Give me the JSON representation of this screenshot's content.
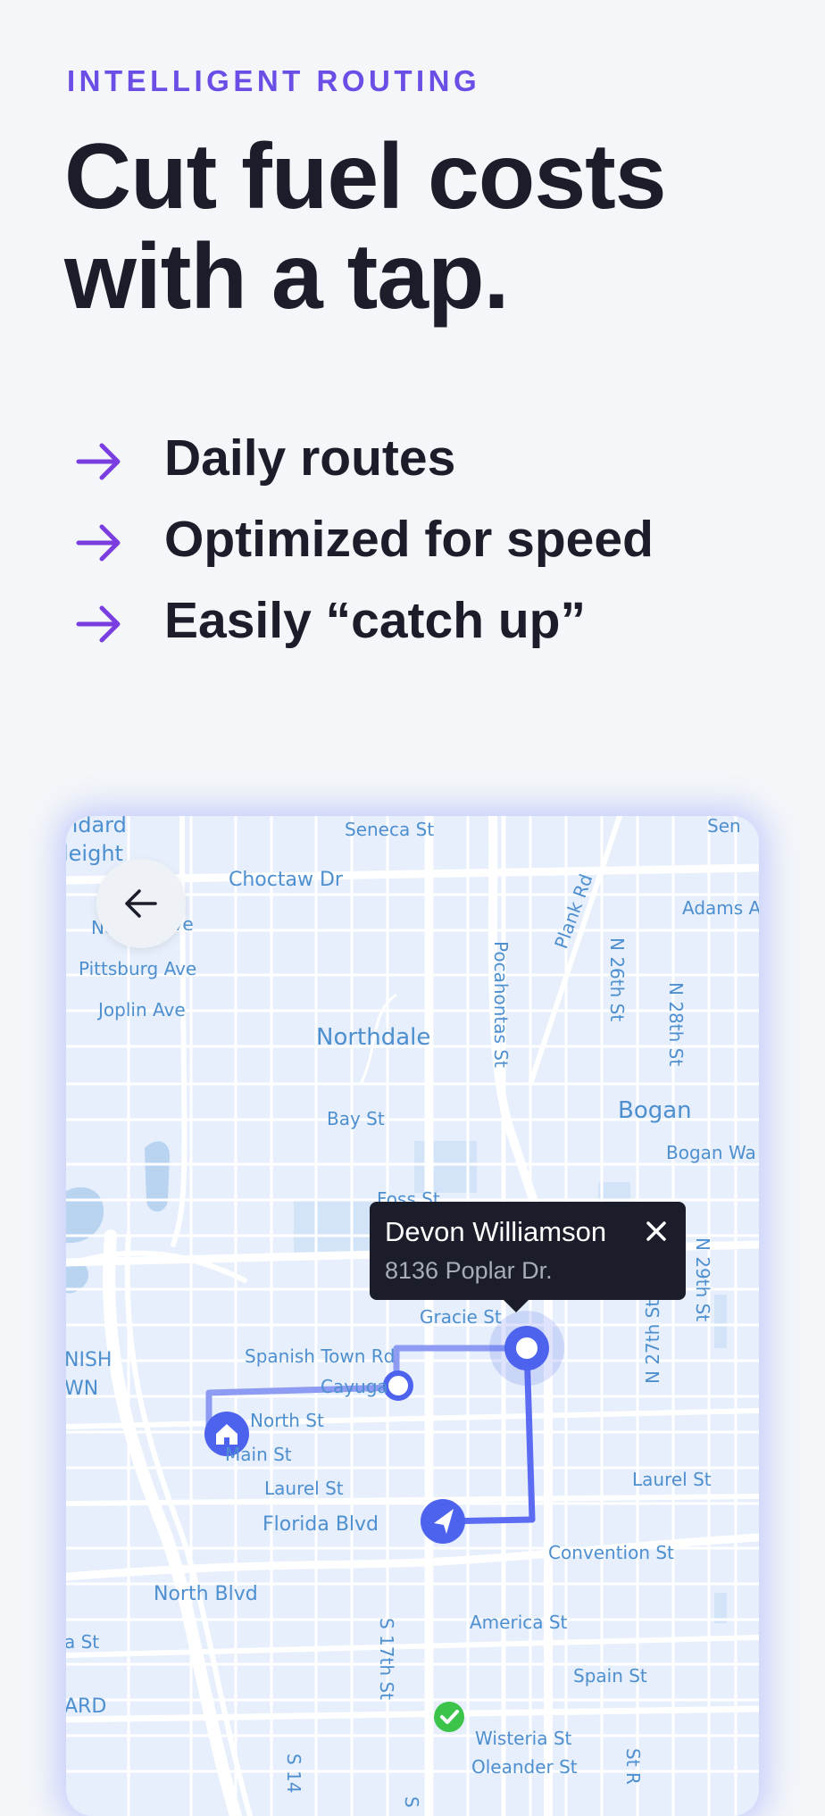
{
  "eyebrow": "INTELLIGENT ROUTING",
  "headline": {
    "line1": "Cut fuel costs",
    "line2": "with a tap."
  },
  "features": [
    {
      "icon": "arrow-right-icon",
      "label": "Daily routes"
    },
    {
      "icon": "arrow-right-icon",
      "label": "Optimized for speed"
    },
    {
      "icon": "arrow-right-icon",
      "label": "Easily “catch up”"
    }
  ],
  "map": {
    "back_icon": "arrow-left-icon",
    "popup": {
      "name": "Devon Williamson",
      "address": "8136 Poplar Dr.",
      "close_icon": "close-icon"
    },
    "markers": [
      "home-icon",
      "navigation-arrow-icon",
      "check-icon"
    ],
    "labels": {
      "standard": "ndard",
      "heights": "leight",
      "seneca_st": "Seneca St",
      "sen": "Sen",
      "choctaw": "Choctaw Dr",
      "nez": "Nez",
      "ave": "Ave",
      "pittsburg": "Pittsburg Ave",
      "joplin": "Joplin Ave",
      "northdale": "Northdale",
      "pocahontas": "Pocahontas St",
      "plank": "Plank Rd",
      "n26": "N 26th St",
      "n28": "N 28th St",
      "adams": "Adams A",
      "bogan": "Bogan",
      "bogan_way": "Bogan Wa",
      "bay": "Bay St",
      "foss": "Foss St",
      "gracie": "Gracie St",
      "spanish_town": "Spanish Town Rd",
      "cayuga": "Cayuga",
      "nish": "NISH",
      "wn": "WN",
      "north_st": "North St",
      "main_st": "Main St",
      "laurel_st": "Laurel St",
      "laurel_st_2": "Laurel St",
      "florida": "Florida Blvd",
      "n29": "N 29th St",
      "n27": "N 27th St",
      "convention": "Convention St",
      "north_blvd": "North Blvd",
      "s17": "S 17th St",
      "america": "America St",
      "a_st": "a St",
      "ard": "ARD",
      "spain": "Spain St",
      "wisteria": "Wisteria St",
      "oleander": "Oleander St",
      "s14": "S 14",
      "s1": "S",
      "st_r": "St R"
    },
    "colors": {
      "route": "#5b6cf2",
      "marker": "#4d63ee",
      "check": "#3cc44a",
      "popup_bg": "#1b1d2b"
    }
  }
}
